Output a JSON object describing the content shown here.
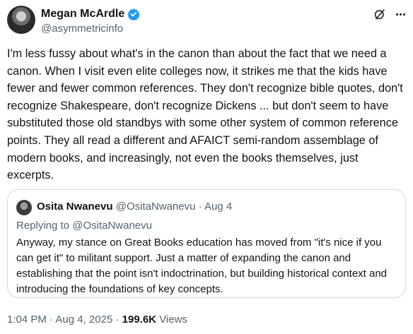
{
  "author": {
    "name": "Megan McArdle",
    "handle": "@asymmetricinfo"
  },
  "tweet": {
    "text": "I'm less fussy about what's in the canon than about the fact that we need a canon. When I visit even elite colleges now, it strikes me that the kids have fewer and fewer common references. They don't recognize bible quotes, don't recognize Shakespeare, don't recognize Dickens ... but don't seem to have substituted those old standbys with some other system of common reference points. They all read a different and AFAICT semi-random assemblage of modern books, and increasingly, not even the books themselves, just excerpts."
  },
  "quoted_tweet": {
    "name": "Osita Nwanevu",
    "handle": "@OsitaNwanevu",
    "separator": "·",
    "date": "Aug 4",
    "replying_to": "Replying to @OsitaNwanevu",
    "text": "Anyway, my stance on Great Books education has moved from \"it's nice if you can get it\" to militant support. Just a matter of expanding the canon and establishing that the point isn't indoctrination, but building historical context and introducing the foundations of key concepts."
  },
  "footer": {
    "time": "1:04 PM",
    "separator": "·",
    "date": "Aug 4, 2025",
    "views_count": "199.6K",
    "views_label": "Views"
  },
  "icons": {
    "verified": "verified-badge-icon",
    "grok": "grok-icon",
    "more": "more-options-icon"
  },
  "colors": {
    "verified_blue": "#1d9bf0",
    "secondary_text": "#536471",
    "primary_text": "#0f1419",
    "border": "#cfd9de"
  }
}
